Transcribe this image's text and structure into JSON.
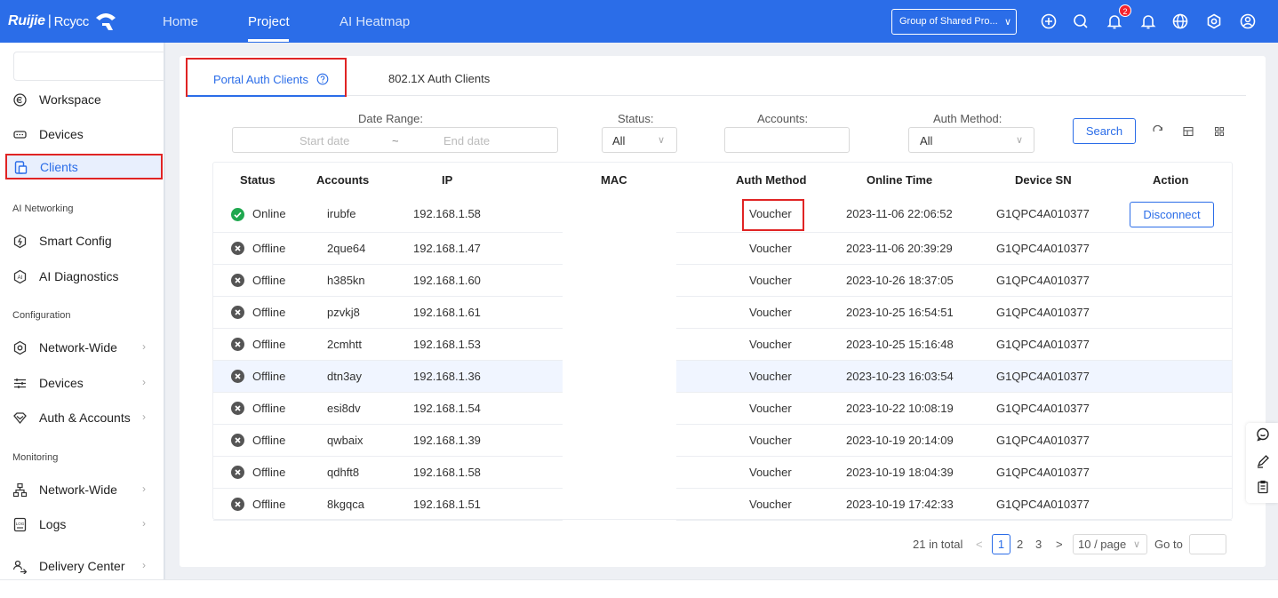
{
  "header": {
    "brand": "Ruijie",
    "brand_sep": "|",
    "brand_sub": "Rcycc",
    "nav": [
      {
        "label": "Home"
      },
      {
        "label": "Project"
      },
      {
        "label": "AI Heatmap"
      }
    ],
    "project_select": "Group of Shared Pro...",
    "notification_count": "2",
    "icons": [
      "plus-circle-icon",
      "search-icon",
      "notification-bell-icon",
      "bell-icon",
      "globe-icon",
      "settings-icon",
      "user-icon"
    ]
  },
  "sidebar": {
    "items": [
      {
        "label": "Workspace",
        "icon": "workspace-icon"
      },
      {
        "label": "Devices",
        "icon": "devices-icon"
      },
      {
        "label": "Clients",
        "icon": "clients-icon"
      },
      {
        "label": "Smart Config",
        "icon": "smart-config-icon"
      },
      {
        "label": "AI Diagnostics",
        "icon": "ai-diagnostics-icon"
      },
      {
        "label": "Network-Wide",
        "icon": "network-settings-icon"
      },
      {
        "label": "Devices",
        "icon": "device-config-icon"
      },
      {
        "label": "Auth & Accounts",
        "icon": "auth-icon"
      },
      {
        "label": "Network-Wide",
        "icon": "network-topology-icon"
      },
      {
        "label": "Logs",
        "icon": "logs-icon"
      },
      {
        "label": "Delivery Center",
        "icon": "delivery-icon"
      }
    ],
    "groups": [
      "AI Networking",
      "Configuration",
      "Monitoring"
    ]
  },
  "tabs": {
    "portal": "Portal Auth Clients",
    "dot1x": "802.1X Auth Clients"
  },
  "filters": {
    "date_range_label": "Date Range:",
    "start_placeholder": "Start date",
    "range_sep": "~",
    "end_placeholder": "End date",
    "status_label": "Status:",
    "status_value": "All",
    "accounts_label": "Accounts:",
    "auth_label": "Auth Method:",
    "auth_value": "All",
    "search": "Search"
  },
  "table": {
    "headers": [
      "Status",
      "Accounts",
      "IP",
      "MAC",
      "Auth Method",
      "Online Time",
      "Device SN",
      "Action"
    ],
    "rows": [
      {
        "status": "Online",
        "account": "irubfe",
        "ip": "192.168.1.58",
        "mac": "",
        "auth": "Voucher",
        "time": "2023-11-06 22:06:52",
        "sn": "G1QPC4A010377",
        "action": "Disconnect"
      },
      {
        "status": "Offline",
        "account": "2que64",
        "ip": "192.168.1.47",
        "mac": "",
        "auth": "Voucher",
        "time": "2023-11-06 20:39:29",
        "sn": "G1QPC4A010377",
        "action": ""
      },
      {
        "status": "Offline",
        "account": "h385kn",
        "ip": "192.168.1.60",
        "mac": "",
        "auth": "Voucher",
        "time": "2023-10-26 18:37:05",
        "sn": "G1QPC4A010377",
        "action": ""
      },
      {
        "status": "Offline",
        "account": "pzvkj8",
        "ip": "192.168.1.61",
        "mac": "",
        "auth": "Voucher",
        "time": "2023-10-25 16:54:51",
        "sn": "G1QPC4A010377",
        "action": ""
      },
      {
        "status": "Offline",
        "account": "2cmhtt",
        "ip": "192.168.1.53",
        "mac": "",
        "auth": "Voucher",
        "time": "2023-10-25 15:16:48",
        "sn": "G1QPC4A010377",
        "action": ""
      },
      {
        "status": "Offline",
        "account": "dtn3ay",
        "ip": "192.168.1.36",
        "mac": "",
        "auth": "Voucher",
        "time": "2023-10-23 16:03:54",
        "sn": "G1QPC4A010377",
        "action": ""
      },
      {
        "status": "Offline",
        "account": "esi8dv",
        "ip": "192.168.1.54",
        "mac": "",
        "auth": "Voucher",
        "time": "2023-10-22 10:08:19",
        "sn": "G1QPC4A010377",
        "action": ""
      },
      {
        "status": "Offline",
        "account": "qwbaix",
        "ip": "192.168.1.39",
        "mac": "",
        "auth": "Voucher",
        "time": "2023-10-19 20:14:09",
        "sn": "G1QPC4A010377",
        "action": ""
      },
      {
        "status": "Offline",
        "account": "qdhft8",
        "ip": "192.168.1.58",
        "mac": "",
        "auth": "Voucher",
        "time": "2023-10-19 18:04:39",
        "sn": "G1QPC4A010377",
        "action": ""
      },
      {
        "status": "Offline",
        "account": "8kgqca",
        "ip": "192.168.1.51",
        "mac": "",
        "auth": "Voucher",
        "time": "2023-10-19 17:42:33",
        "sn": "G1QPC4A010377",
        "action": ""
      }
    ]
  },
  "pagination": {
    "total": "21 in total",
    "prev": "<",
    "pages": [
      "1",
      "2",
      "3"
    ],
    "next": ">",
    "page_size": "10 / page",
    "goto": "Go to"
  },
  "colors": {
    "primary": "#2b6de8",
    "online": "#1fa84f",
    "offline": "#555555",
    "highlight": "#e02424"
  }
}
